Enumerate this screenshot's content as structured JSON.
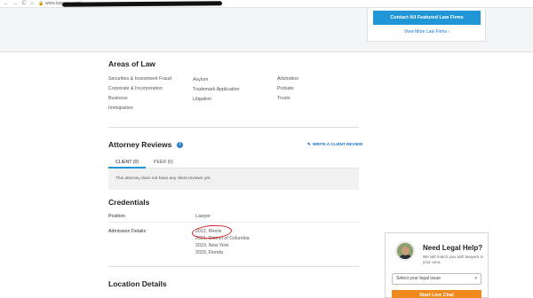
{
  "browser": {
    "back": "←",
    "forward": "→",
    "reload": "C",
    "home": "⌂",
    "lock": "🔒",
    "url": "www.lawyers.com/"
  },
  "top_cta": {
    "button": "Contact All Featured Law Firms",
    "link": "View More Law Firms ›"
  },
  "areas_of_law": {
    "title": "Areas of Law",
    "items": [
      "Securities & Investment Fraud",
      "Corporate & Incorporation",
      "Business",
      "Immigration",
      "Asylum",
      "Trademark Application",
      "Litigation",
      "Arbitration",
      "Probate",
      "Trusts"
    ]
  },
  "reviews": {
    "title": "Attorney Reviews",
    "info_icon": "i",
    "write_review": "WRITE A CLIENT REVIEW",
    "tabs": [
      "CLIENT (0)",
      "PEER (0)"
    ],
    "empty_message": "This attorney does not have any client reviews yet."
  },
  "credentials": {
    "title": "Credentials",
    "position_label": "Position",
    "position_value": "Lawyer",
    "admission_label": "Admission Details",
    "admissions": [
      "2012, Illinois",
      "2021, District of Columbia",
      "2019, New York",
      "2020, Florida"
    ]
  },
  "location": {
    "title": "Location Details"
  },
  "help_widget": {
    "title": "Need Legal Help?",
    "subtitle": "We will match you with lawyers in your area.",
    "select_placeholder": "Select your legal issue",
    "button": "Start Live Chat"
  },
  "colors": {
    "accent_blue": "#2196d6",
    "link_blue": "#1a73c7",
    "cta_orange": "#f08a1c",
    "annotation_red": "#d41e1e"
  }
}
